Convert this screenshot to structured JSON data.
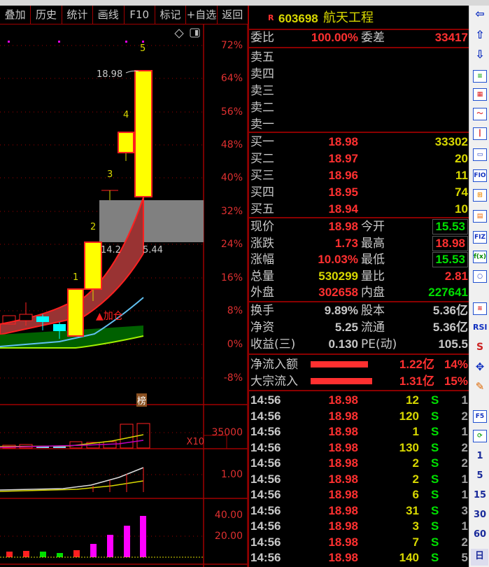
{
  "toolbar": [
    "叠加",
    "历史",
    "统计",
    "画线",
    "F10",
    "标记",
    "+自选",
    "返回"
  ],
  "chart": {
    "axis_pct": [
      "72%",
      "64%",
      "56%",
      "48%",
      "40%",
      "32%",
      "24%",
      "16%",
      "8%",
      "0%",
      "-8%"
    ],
    "price_label": "18.98",
    "box_left": "14.2",
    "box_right": "5.44",
    "wave_labels": [
      "1",
      "2",
      "3",
      "4",
      "5"
    ],
    "add_position": "▲加仓",
    "rank_badge": "榜",
    "vol_axis": "35000",
    "vol_unit": "X10",
    "mid_axis": "1.00",
    "low_axis": [
      "40.00",
      "20.00"
    ]
  },
  "quote": {
    "flag": "R",
    "code": "603698",
    "name": "航天工程",
    "wb_label": "委比",
    "wb": "100.00%",
    "wc_label": "委差",
    "wc": "33417",
    "sell": [
      "卖五",
      "卖四",
      "卖三",
      "卖二",
      "卖一"
    ],
    "buy": [
      {
        "label": "买一",
        "price": "18.98",
        "vol": "33302"
      },
      {
        "label": "买二",
        "price": "18.97",
        "vol": "20"
      },
      {
        "label": "买三",
        "price": "18.96",
        "vol": "11"
      },
      {
        "label": "买四",
        "price": "18.95",
        "vol": "74"
      },
      {
        "label": "买五",
        "price": "18.94",
        "vol": "10"
      }
    ],
    "stats": [
      {
        "l1": "现价",
        "v1": "18.98",
        "c1": "r",
        "l2": "今开",
        "v2": "15.53",
        "c2": "g",
        "box": true
      },
      {
        "l1": "涨跌",
        "v1": "1.73",
        "c1": "r",
        "l2": "最高",
        "v2": "18.98",
        "c2": "r",
        "box": true
      },
      {
        "l1": "涨幅",
        "v1": "10.03%",
        "c1": "r",
        "l2": "最低",
        "v2": "15.53",
        "c2": "g",
        "box": true
      },
      {
        "l1": "总量",
        "v1": "530299",
        "c1": "y",
        "l2": "量比",
        "v2": "2.81",
        "c2": "r"
      },
      {
        "l1": "外盘",
        "v1": "302658",
        "c1": "r",
        "l2": "内盘",
        "v2": "227641",
        "c2": "g"
      }
    ],
    "fund": [
      {
        "l1": "换手",
        "v1": "9.89%",
        "l2": "股本",
        "v2": "5.36亿"
      },
      {
        "l1": "净资",
        "v1": "5.25",
        "l2": "流通",
        "v2": "5.36亿"
      },
      {
        "l1": "收益(三)",
        "v1": "0.130",
        "l2": "PE(动)",
        "v2": "105.5"
      }
    ],
    "flows": [
      {
        "label": "净流入额",
        "amount": "1.22亿",
        "pct": "14%",
        "bar": 0.77
      },
      {
        "label": "大宗流入",
        "amount": "1.31亿",
        "pct": "15%",
        "bar": 0.83
      }
    ],
    "trades": [
      [
        "14:56",
        "18.98",
        "12",
        "S",
        "1"
      ],
      [
        "14:56",
        "18.98",
        "120",
        "S",
        "2"
      ],
      [
        "14:56",
        "18.98",
        "1",
        "S",
        "1"
      ],
      [
        "14:56",
        "18.98",
        "130",
        "S",
        "2"
      ],
      [
        "14:56",
        "18.98",
        "2",
        "S",
        "2"
      ],
      [
        "14:56",
        "18.98",
        "2",
        "S",
        "1"
      ],
      [
        "14:56",
        "18.98",
        "6",
        "S",
        "1"
      ],
      [
        "14:56",
        "18.98",
        "31",
        "S",
        "3"
      ],
      [
        "14:56",
        "18.98",
        "3",
        "S",
        "1"
      ],
      [
        "14:56",
        "18.98",
        "7",
        "S",
        "2"
      ],
      [
        "14:56",
        "18.98",
        "140",
        "S",
        "5"
      ]
    ]
  },
  "sidebar": {
    "f10": "FIO",
    "f12": "FIZ",
    "fx": "f(x)",
    "rsi": "RSI",
    "s": "S",
    "f5": "F5",
    "periods": [
      "1",
      "5",
      "15",
      "30",
      "60"
    ],
    "day": "日"
  }
}
